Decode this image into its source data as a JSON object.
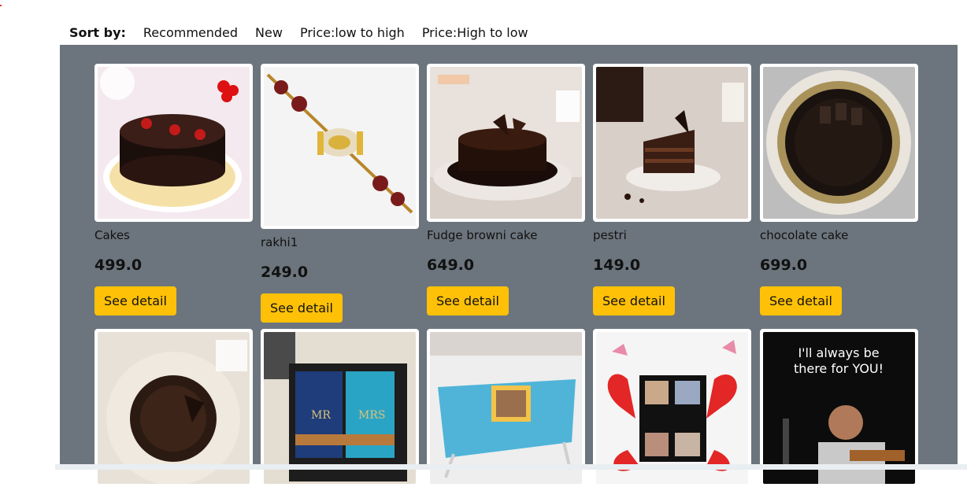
{
  "sort": {
    "label": "Sort by:",
    "options": [
      "Recommended",
      "New",
      "Price:low to high",
      "Price:High to low"
    ]
  },
  "products_row1": [
    {
      "name": "Cakes",
      "price": "499.0",
      "button": "See detail",
      "image": "chocolate-cake-cherries"
    },
    {
      "name": "rakhi1",
      "price": "249.0",
      "button": "See detail",
      "image": "rakhi-bracelet"
    },
    {
      "name": "Fudge browni cake",
      "price": "649.0",
      "button": "See detail",
      "image": "fudge-brownie-cake"
    },
    {
      "name": "pestri",
      "price": "149.0",
      "button": "See detail",
      "image": "chocolate-pastry-slice"
    },
    {
      "name": "chocolate cake",
      "price": "699.0",
      "button": "See detail",
      "image": "round-chocolate-cake"
    }
  ],
  "products_row2": [
    {
      "image": "chocolate-cake-plate"
    },
    {
      "image": "mr-mrs-passport-covers"
    },
    {
      "image": "kids-laptop-table"
    },
    {
      "image": "explosion-photo-box"
    },
    {
      "image": "singer-poster",
      "poster_text_1": "I'll always be",
      "poster_text_2": "there for YOU!"
    }
  ],
  "colors": {
    "panel": "#6c757d",
    "button": "#ffc107"
  }
}
